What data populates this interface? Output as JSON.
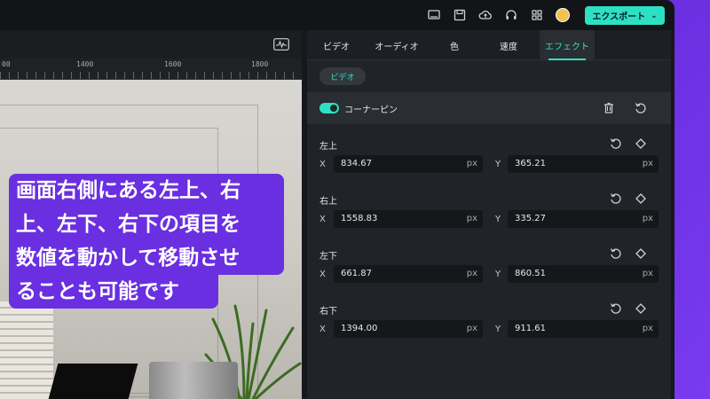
{
  "header": {
    "export_label": "エクスポート",
    "icons": [
      "monitor-icon",
      "save-icon",
      "cloud-upload-icon",
      "headset-icon",
      "grid-icon",
      "avatar"
    ]
  },
  "ruler": {
    "labels": [
      "00",
      "1400",
      "1600",
      "1800"
    ]
  },
  "caption": {
    "line1": "画面右側にある左上、右",
    "line2": "上、左下、右下の項目を",
    "line3": "数値を動かして移動させ",
    "line4": "ることも可能です"
  },
  "panel": {
    "tabs": [
      {
        "label": "ビデオ"
      },
      {
        "label": "オーディオ"
      },
      {
        "label": "色"
      },
      {
        "label": "速度"
      },
      {
        "label": "エフェクト"
      }
    ],
    "subtab": "ビデオ",
    "effect_name": "コーナーピン",
    "groups": [
      {
        "label": "左上",
        "x_label": "X",
        "x": "834.67",
        "y_label": "Y",
        "y": "365.21",
        "unit": "px"
      },
      {
        "label": "右上",
        "x_label": "X",
        "x": "1558.83",
        "y_label": "Y",
        "y": "335.27",
        "unit": "px"
      },
      {
        "label": "左下",
        "x_label": "X",
        "x": "661.87",
        "y_label": "Y",
        "y": "860.51",
        "unit": "px"
      },
      {
        "label": "右下",
        "x_label": "X",
        "x": "1394.00",
        "y_label": "Y",
        "y": "911.61",
        "unit": "px"
      }
    ]
  },
  "colors": {
    "accent": "#2de0c5",
    "caption_bg": "#6a2fe0",
    "panel_bg": "#202327"
  }
}
